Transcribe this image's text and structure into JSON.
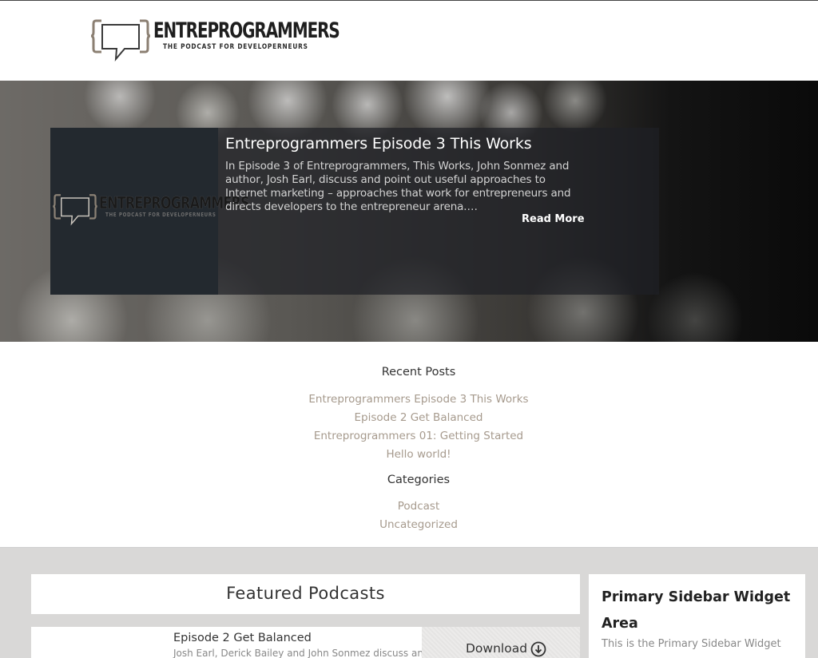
{
  "header": {
    "logo_title": "ENTREPROGRAMMERS",
    "logo_tagline": "THE PODCAST FOR DEVELOPERNEURS",
    "logo_icon": "speech-bubble-braces-icon"
  },
  "hero": {
    "thumb_logo_title": "ENTREPROGRAMMERS",
    "thumb_logo_tagline": "THE PODCAST FOR DEVELOPERNEURS",
    "title": "Entreprogrammers Episode 3 This Works",
    "excerpt": "In Episode 3 of Entreprogrammers, This Works, John Sonmez and author, Josh Earl, discuss and point out useful approaches to Internet marketing – approaches that work for entrepreneurs and directs developers to the entrepreneur arena.…",
    "read_more": "Read More"
  },
  "recent_posts": {
    "heading": "Recent Posts",
    "items": [
      "Entreprogrammers Episode 3 This Works",
      "Episode 2 Get Balanced",
      "Entreprogrammers 01: Getting Started",
      "Hello world!"
    ]
  },
  "categories": {
    "heading": "Categories",
    "items": [
      "Podcast",
      "Uncategorized"
    ]
  },
  "featured": {
    "title": "Featured Podcasts",
    "episode": {
      "title": "Episode 2 Get Balanced",
      "description": "Josh Earl, Derick Bailey and John Sonmez discuss and",
      "download_label": "Download",
      "download_icon": "download-circle-icon"
    }
  },
  "sidebar": {
    "title": "Primary Sidebar Widget Area",
    "text": "This is the Primary Sidebar Widget"
  },
  "colors": {
    "link": "#a69a8d",
    "band": "#d9d8d7",
    "hero_card": "#23292f"
  }
}
